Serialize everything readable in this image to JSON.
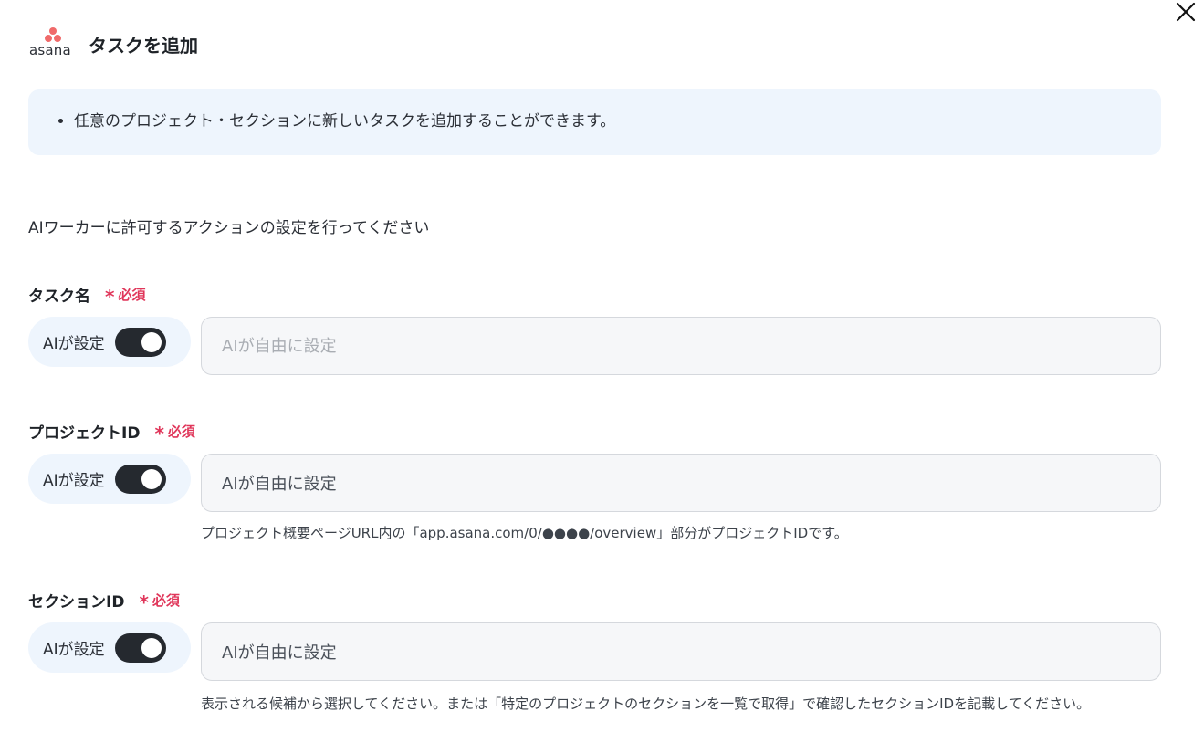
{
  "header": {
    "logo_text": "asana",
    "title": "タスクを追加"
  },
  "info": {
    "bullet": "任意のプロジェクト・セクションに新しいタスクを追加することができます。"
  },
  "instruction": "AIワーカーに許可するアクションの設定を行ってください",
  "fields": [
    {
      "label": "タスク名",
      "required": "必須",
      "ai_label": "AIが設定",
      "ai_enabled": true,
      "value": "",
      "placeholder": "AIが自由に設定",
      "helper": ""
    },
    {
      "label": "プロジェクトID",
      "required": "必須",
      "ai_label": "AIが設定",
      "ai_enabled": true,
      "value": "AIが自由に設定",
      "placeholder": "",
      "helper": "プロジェクト概要ページURL内の「app.asana.com/0/●●●●/overview」部分がプロジェクトIDです。"
    },
    {
      "label": "セクションID",
      "required": "必須",
      "ai_label": "AIが設定",
      "ai_enabled": true,
      "value": "AIが自由に設定",
      "placeholder": "",
      "helper": "表示される候補から選択してください。または「特定のプロジェクトのセクションを一覧で取得」で確認したセクションIDを記載してください。"
    }
  ],
  "colors": {
    "brand": "#f06a6a",
    "required": "#e0365a",
    "info_bg": "#eef5fd",
    "toggle_on": "#25292f"
  },
  "icons": {
    "close": "close-icon",
    "logo": "asana-logo"
  }
}
